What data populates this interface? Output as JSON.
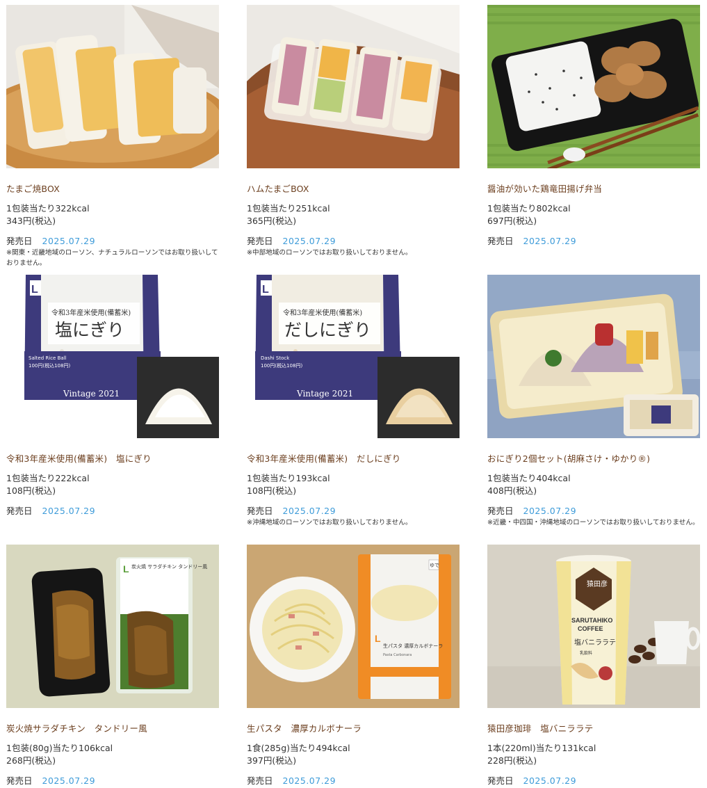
{
  "labels": {
    "release": "発売日"
  },
  "products": [
    {
      "name": "たまご焼BOX",
      "kcal": "1包装当たり322kcal",
      "price": "343円(税込)",
      "date": "2025.07.29",
      "note": "※関東・近畿地域のローソン、ナチュラルローソンではお取り扱いしておりません。"
    },
    {
      "name": "ハムたまごBOX",
      "kcal": "1包装当たり251kcal",
      "price": "365円(税込)",
      "date": "2025.07.29",
      "note": "※中部地域のローソンではお取り扱いしておりません。"
    },
    {
      "name": "醤油が効いた鶏竜田揚げ弁当",
      "kcal": "1包装当たり802kcal",
      "price": "697円(税込)",
      "date": "2025.07.29",
      "note": ""
    },
    {
      "name": "令和3年産米使用(備蓄米)　塩にぎり",
      "kcal": "1包装当たり222kcal",
      "price": "108円(税込)",
      "date": "2025.07.29",
      "note": "",
      "pkg": {
        "top": "令和3年産米使用(備蓄米)",
        "title": "塩にぎり",
        "sub": "Salted Rice Ball",
        "price": "100円(税込108円)",
        "vintage": "Vintage 2021"
      }
    },
    {
      "name": "令和3年産米使用(備蓄米)　だしにぎり",
      "kcal": "1包装当たり193kcal",
      "price": "108円(税込)",
      "date": "2025.07.29",
      "note": "※沖縄地域のローソンではお取り扱いしておりません。",
      "pkg": {
        "top": "令和3年産米使用(備蓄米)",
        "title": "だしにぎり",
        "sub": "Dashi Stock",
        "price": "100円(税込108円)",
        "vintage": "Vintage 2021"
      }
    },
    {
      "name": "おにぎり2個セット(胡麻さけ・ゆかり®)",
      "kcal": "1包装当たり404kcal",
      "price": "408円(税込)",
      "date": "2025.07.29",
      "note": "※近畿・中四国・沖縄地域のローソンではお取り扱いしておりません。"
    },
    {
      "name": "炭火焼サラダチキン　タンドリー風",
      "kcal": "1包装(80g)当たり106kcal",
      "price": "268円(税込)",
      "date": "2025.07.29",
      "note": "",
      "pkg": {
        "title": "炭火焼 サラダチキン タンドリー風"
      }
    },
    {
      "name": "生パスタ　濃厚カルボナーラ",
      "kcal": "1食(285g)当たり494kcal",
      "price": "397円(税込)",
      "date": "2025.07.29",
      "note": "",
      "pkg": {
        "title": "生パスタ 濃厚カルボナーラ",
        "sub": "Pasta Carbonara",
        "tag": "ゆで"
      }
    },
    {
      "name": "猿田彦珈琲　塩バニララテ",
      "kcal": "1本(220ml)当たり131kcal",
      "price": "228円(税込)",
      "date": "2025.07.29",
      "note": "",
      "pkg": {
        "logo": "猿田彦",
        "brand1": "SARUTAHIKO",
        "brand2": "COFFEE",
        "title": "塩バニララテ",
        "kind": "乳飲料"
      }
    }
  ]
}
